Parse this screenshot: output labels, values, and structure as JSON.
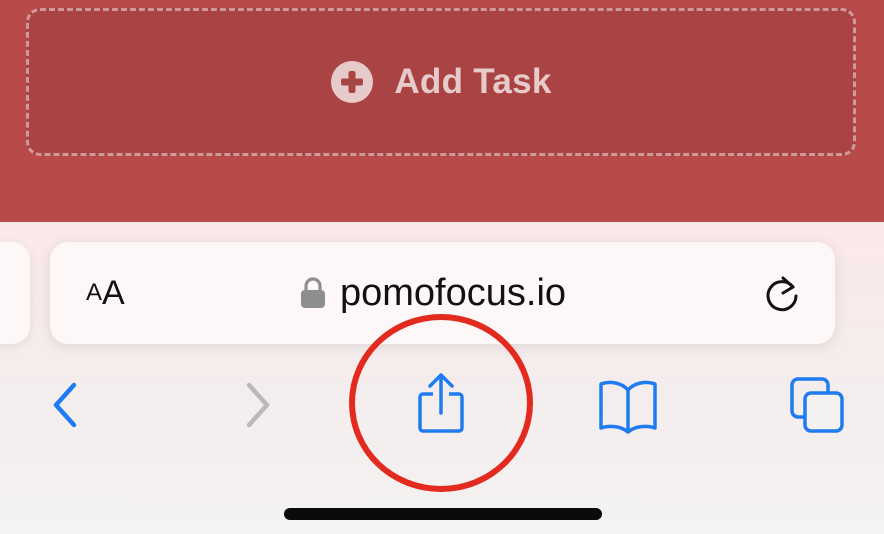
{
  "page": {
    "add_task_label": "Add Task",
    "colors": {
      "brand_red": "#b94a4a",
      "ios_blue": "#1f7bf0",
      "disabled_gray": "#b9b9b9",
      "annotation_red": "#e22a1f"
    }
  },
  "browser": {
    "text_size_small": "A",
    "text_size_big": "A",
    "url": "pomofocus.io",
    "icons": {
      "lock": "lock-icon",
      "reload": "reload-icon",
      "back": "chevron-left-icon",
      "forward": "chevron-right-icon",
      "share": "share-icon",
      "bookmarks": "book-icon",
      "tabs": "tabs-icon"
    }
  }
}
